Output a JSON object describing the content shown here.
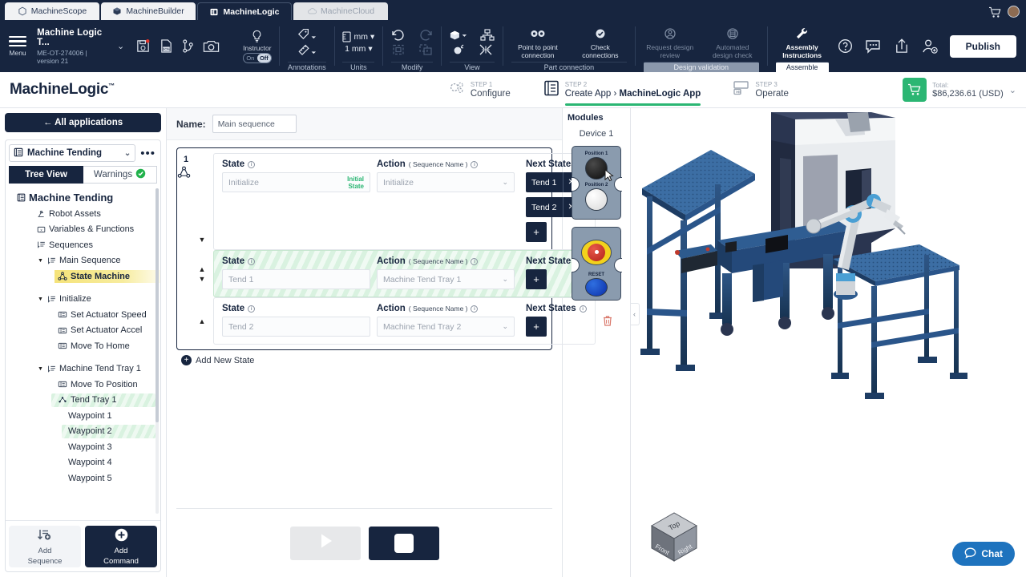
{
  "tabs": [
    {
      "label": "MachineScope",
      "icon": "hex-icon",
      "state": "inactive"
    },
    {
      "label": "MachineBuilder",
      "icon": "cube-icon",
      "state": "inactive"
    },
    {
      "label": "MachineLogic",
      "icon": "logic-icon",
      "state": "active"
    },
    {
      "label": "MachineCloud",
      "icon": "cloud-icon",
      "state": "ghost"
    }
  ],
  "titlebar": {
    "cart_icon": "cart-icon",
    "avatar": "user-avatar"
  },
  "toolbar": {
    "menu_label": "Menu",
    "project_name": "Machine Logic T...",
    "project_sub": "ME-OT-274006 | version 21",
    "file_icons": [
      {
        "name": "save-icon",
        "title": "Save"
      },
      {
        "name": "bom-icon",
        "title": "BOM"
      },
      {
        "name": "branch-icon",
        "title": "Versions"
      },
      {
        "name": "camera-icon",
        "title": "Screenshot"
      }
    ],
    "instructor_label": "Instructor",
    "toggle_on": "On",
    "toggle_off": "Off",
    "groups": [
      {
        "name": "Annotations",
        "state": "normal",
        "items": [
          {
            "label": "",
            "icon": "tag-icon"
          },
          {
            "label": "",
            "icon": "ruler-icon"
          }
        ]
      },
      {
        "name": "Units",
        "state": "normal",
        "items": [
          {
            "label": "mm",
            "icon": "unit-icon"
          },
          {
            "label": "1 mm",
            "icon": "precision-icon"
          }
        ]
      },
      {
        "name": "Modify",
        "state": "normal",
        "items": [
          {
            "label": "",
            "icon": "undo-icon"
          },
          {
            "label": "",
            "icon": "redo-icon"
          },
          {
            "label": "",
            "icon": "group-icon"
          },
          {
            "label": "",
            "icon": "ungroup-icon"
          }
        ]
      },
      {
        "name": "View",
        "state": "normal",
        "items": [
          {
            "label": "",
            "icon": "cube-view-icon"
          },
          {
            "label": "",
            "icon": "tree-icon"
          },
          {
            "label": "",
            "icon": "explode-icon"
          },
          {
            "label": "",
            "icon": "collapse-icon"
          }
        ]
      },
      {
        "name": "Part connection",
        "state": "normal",
        "items": [
          {
            "label": "Point to point connection",
            "icon": "link-icon"
          },
          {
            "label": "Check connections",
            "icon": "check-link-icon"
          }
        ]
      },
      {
        "name": "Design validation",
        "state": "disabled",
        "items": [
          {
            "label": "Request design review",
            "icon": "review-icon"
          },
          {
            "label": "Automated design check",
            "icon": "auto-check-icon"
          }
        ]
      },
      {
        "name": "Assemble",
        "state": "selected",
        "items": [
          {
            "label": "Assembly Instructions",
            "icon": "wrench-icon"
          }
        ]
      }
    ],
    "right_icons": [
      {
        "name": "help-icon"
      },
      {
        "name": "feedback-icon"
      },
      {
        "name": "share-icon"
      },
      {
        "name": "add-user-icon"
      }
    ],
    "publish_label": "Publish"
  },
  "stepbar": {
    "logo": "MachineLogic",
    "logo_tm": "™",
    "steps": [
      {
        "num": "STEP 1",
        "label": "Configure",
        "icon": "gear-icon",
        "active": false
      },
      {
        "num": "STEP 2",
        "label": "Create App",
        "crumb": "MachineLogic App",
        "icon": "app-icon",
        "active": true
      },
      {
        "num": "STEP 3",
        "label": "Operate",
        "icon": "operate-icon",
        "active": false
      }
    ],
    "total_label": "Total:",
    "total_value": "$86,236.61 (USD)",
    "accent_green": "#2bb673"
  },
  "left_panel": {
    "all_applications": "← All applications",
    "app_select": "Machine Tending",
    "more_label": "•••",
    "tab_tree": "Tree View",
    "tab_warnings": "Warnings",
    "tree": [
      {
        "label": "Machine Tending",
        "depth": 0,
        "icon": "app-icon",
        "type": "root"
      },
      {
        "label": "Robot Assets",
        "depth": 1,
        "icon": "robot-icon"
      },
      {
        "label": "Variables & Functions",
        "depth": 1,
        "icon": "variable-icon"
      },
      {
        "label": "Sequences",
        "depth": 1,
        "icon": "sequence-icon"
      },
      {
        "label": "Main Sequence",
        "depth": 2,
        "icon": "sequence-icon",
        "carat": "▼"
      },
      {
        "label": "State Machine",
        "depth": 3,
        "icon": "state-machine-icon",
        "highlight": "yellow",
        "bold": true
      },
      {
        "label": "Initialize",
        "depth": 2,
        "icon": "sequence-icon",
        "carat": "▼",
        "spaced": true
      },
      {
        "label": "Set Actuator Speed",
        "depth": 3,
        "icon": "command-icon"
      },
      {
        "label": "Set Actuator Accel",
        "depth": 3,
        "icon": "command-icon"
      },
      {
        "label": "Move To Home",
        "depth": 3,
        "icon": "command-icon"
      },
      {
        "label": "Machine Tend Tray 1",
        "depth": 2,
        "icon": "sequence-icon",
        "carat": "▼",
        "spaced": true
      },
      {
        "label": "Move To Position",
        "depth": 3,
        "icon": "command-icon"
      },
      {
        "label": "Tend Tray 1",
        "depth": 3,
        "icon": "waypoint-group-icon",
        "highlight": "green"
      },
      {
        "label": "Waypoint 1",
        "depth": 4,
        "icon": ""
      },
      {
        "label": "Waypoint 2",
        "depth": 4,
        "icon": "",
        "highlight": "green"
      },
      {
        "label": "Waypoint 3",
        "depth": 4,
        "icon": ""
      },
      {
        "label": "Waypoint 4",
        "depth": 4,
        "icon": ""
      },
      {
        "label": "Waypoint 5",
        "depth": 4,
        "icon": ""
      }
    ],
    "add_sequence": "Add\nSequence",
    "add_sequence_l1": "Add",
    "add_sequence_l2": "Sequence",
    "add_command_l1": "Add",
    "add_command_l2": "Command"
  },
  "editor": {
    "name_label": "Name:",
    "name_value": "Main sequence",
    "group_number": "1",
    "headers": {
      "state": "State",
      "action": "Action",
      "action_sub": "( Sequence Name )",
      "next": "Next States"
    },
    "rows": [
      {
        "state": "Initialize",
        "initial_badge": "Initial State",
        "action": "Initialize",
        "next_states": [
          {
            "label": "Tend 1"
          },
          {
            "label": "Tend 2"
          }
        ],
        "has_add_chip": true,
        "highlight": false,
        "arrows": [
          "down"
        ]
      },
      {
        "state": "Tend 1",
        "action": "Machine Tend Tray 1",
        "next_states": [],
        "has_add_chip": true,
        "highlight": true,
        "arrows": [
          "up",
          "down"
        ]
      },
      {
        "state": "Tend 2",
        "action": "Machine Tend Tray 2",
        "next_states": [],
        "has_add_chip": true,
        "highlight": false,
        "arrows": [
          "up"
        ]
      }
    ],
    "add_new_state": "Add New State",
    "play_button": "play-icon",
    "stop_button": "stop-icon"
  },
  "modules": {
    "title": "Modules",
    "device": "Device 1",
    "cards": [
      {
        "type": "positions",
        "labels": [
          "Position 1",
          "Position 2"
        ]
      },
      {
        "type": "estop",
        "labels": [
          "RESET"
        ]
      }
    ]
  },
  "viewport": {
    "collapse_icon": "chevron-left-icon",
    "chat_label": "Chat",
    "view_cube": {
      "top": "Top",
      "front": "Front",
      "right": "Right"
    }
  }
}
